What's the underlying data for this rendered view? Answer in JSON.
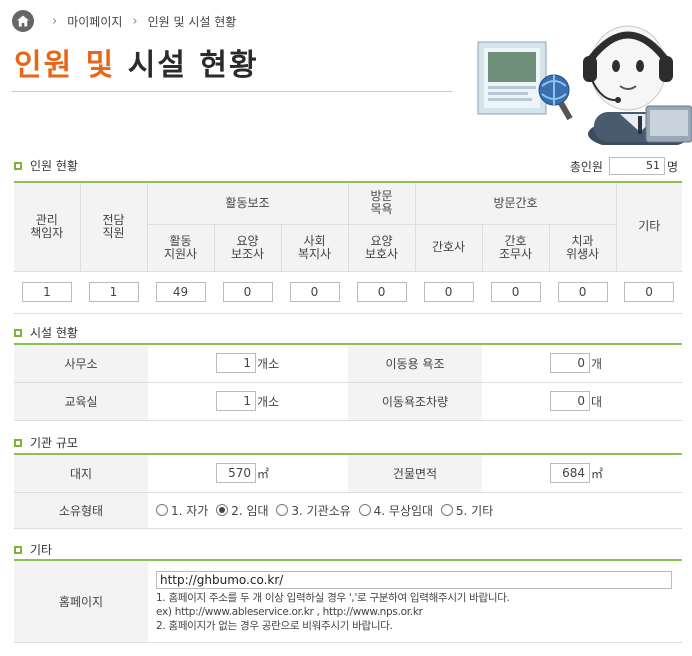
{
  "breadcrumb": {
    "home_icon": "home-icon",
    "item1": "마이페이지",
    "item2": "인원 및 시설 현황"
  },
  "title": {
    "part1": "인원",
    "part2": "및",
    "part3": "시설 현황"
  },
  "staff": {
    "heading": "인원 현황",
    "total_label": "총인원",
    "total_value": "51",
    "total_unit": "명",
    "headers": {
      "manager_line1": "관리",
      "manager_line2": "책임자",
      "dedicated_line1": "전담",
      "dedicated_line2": "직원",
      "activity": "활동보조",
      "visit_bath_line1": "방문",
      "visit_bath_line2": "목욕",
      "visit_nursing": "방문간호",
      "etc": "기타",
      "act_support_line1": "활동",
      "act_support_line2": "지원사",
      "care_aide_line1": "요양",
      "care_aide_line2": "보조사",
      "social_worker_line1": "사회",
      "social_worker_line2": "복지사",
      "care_helper_line1": "요양",
      "care_helper_line2": "보호사",
      "nurse": "간호사",
      "nurse_aide_line1": "간호",
      "nurse_aide_line2": "조무사",
      "dental_line1": "치과",
      "dental_line2": "위생사"
    },
    "values": {
      "manager": "1",
      "dedicated": "1",
      "act_support": "49",
      "care_aide": "0",
      "social_worker": "0",
      "care_helper": "0",
      "nurse": "0",
      "nurse_aide": "0",
      "dental": "0",
      "etc": "0"
    }
  },
  "facility": {
    "heading": "시설 현황",
    "office_label": "사무소",
    "office_value": "1",
    "office_unit": "개소",
    "bath_label": "이동용 욕조",
    "bath_value": "0",
    "bath_unit": "개",
    "edu_label": "교육실",
    "edu_value": "1",
    "edu_unit": "개소",
    "bathcar_label": "이동욕조차량",
    "bathcar_value": "0",
    "bathcar_unit": "대"
  },
  "scale": {
    "heading": "기관 규모",
    "land_label": "대지",
    "land_value": "570",
    "land_unit": "㎡",
    "building_label": "건물면적",
    "building_value": "684",
    "building_unit": "㎡",
    "ownership_label": "소유형태",
    "options": [
      "1. 자가",
      "2. 임대",
      "3. 기관소유",
      "4. 무상임대",
      "5. 기타"
    ],
    "selected_option": "2. 임대"
  },
  "etc": {
    "heading": "기타",
    "homepage_label": "홈페이지",
    "homepage_value": "http://ghbumo.co.kr/",
    "note1": "1. 홈페이지 주소를 두 개 이상 입력하실 경우 ','로 구분하여 입력해주시기 바랍니다.",
    "note2": "ex) http://www.ableservice.or.kr , http://www.nps.or.kr",
    "note3": "2. 홈페이지가 없는 경우 공란으로 비워주시기 바랍니다."
  },
  "colors": {
    "accent_orange": "#e8651a",
    "accent_green": "#8cc152",
    "header_bg": "#f3f3f3"
  }
}
